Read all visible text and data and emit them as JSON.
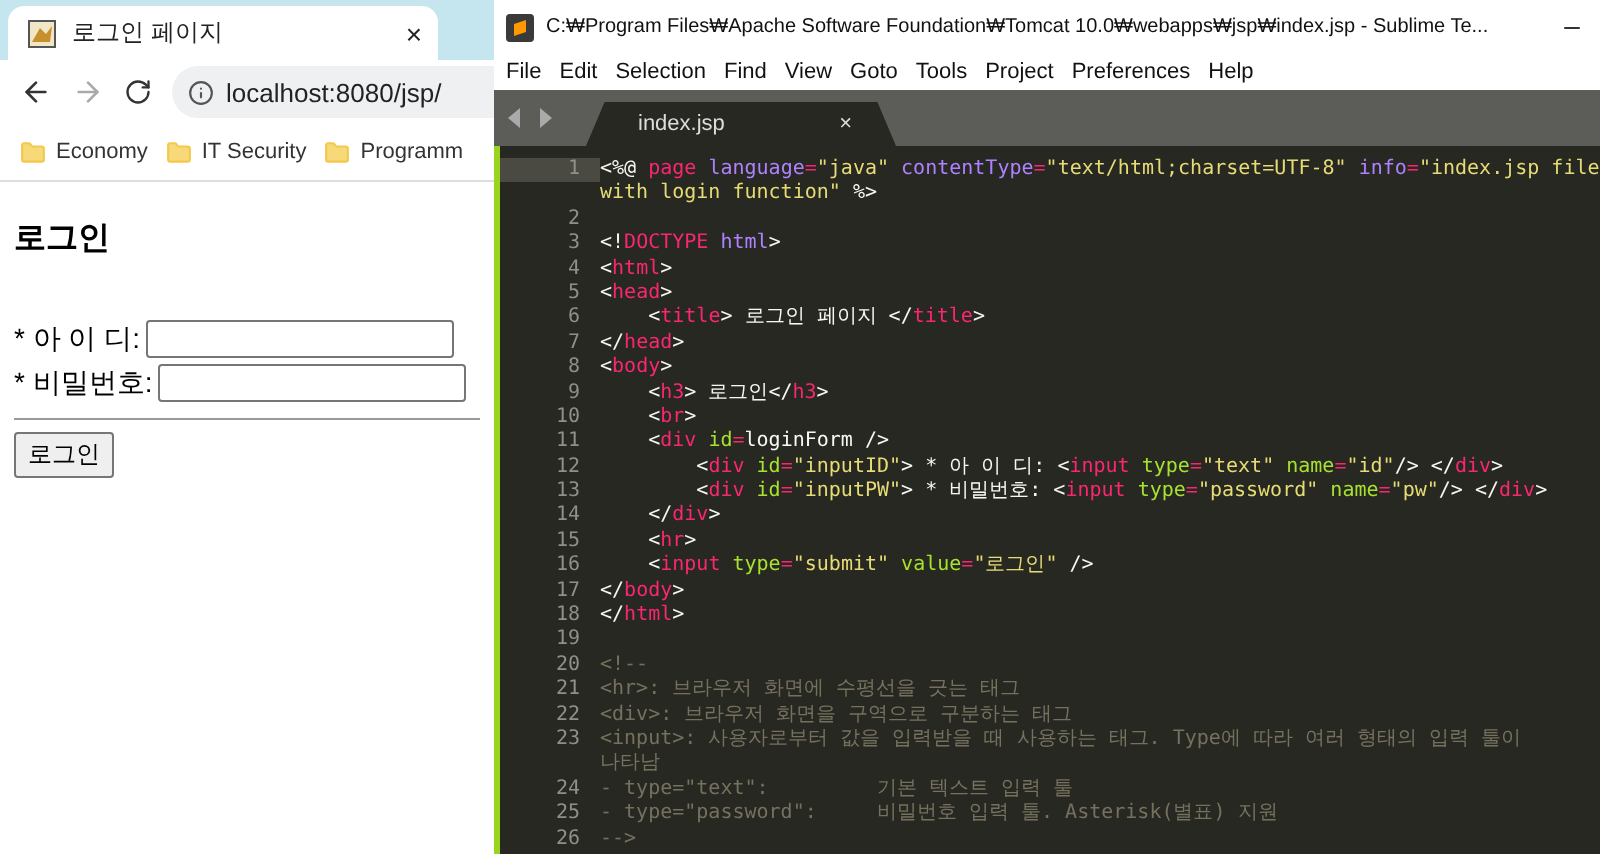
{
  "browser": {
    "tab": {
      "title": "로그인 페이지",
      "close": "×",
      "selected": true
    },
    "address": {
      "url": "localhost:8080/jsp/"
    },
    "bookmarks": [
      "Economy",
      "IT Security",
      "Programm"
    ],
    "page": {
      "heading": "로그인",
      "fields": [
        {
          "label": "* 아 이 디:"
        },
        {
          "label": "* 비밀번호:"
        }
      ],
      "button": "로그인"
    }
  },
  "editor": {
    "title": "C:₩Program Files₩Apache Software Foundation₩Tomcat 10.0₩webapps₩jsp₩index.jsp - Sublime Te...",
    "menu": [
      "File",
      "Edit",
      "Selection",
      "Find",
      "View",
      "Goto",
      "Tools",
      "Project",
      "Preferences",
      "Help"
    ],
    "tab": {
      "name": "index.jsp",
      "close": "×",
      "selected": true
    },
    "lines": [
      {
        "number": "1",
        "current": true,
        "tokens": [
          {
            "kind": "text",
            "text": "<%@"
          },
          {
            "kind": "tag",
            "text": " page"
          },
          {
            "kind": "directive",
            "text": " language"
          },
          {
            "kind": "op",
            "text": "="
          },
          {
            "kind": "string",
            "text": "\"java\""
          },
          {
            "kind": "directive",
            "text": " contentType"
          },
          {
            "kind": "op",
            "text": "="
          },
          {
            "kind": "string",
            "text": "\"text/html;charset=UTF-8\""
          },
          {
            "kind": "directive",
            "text": " info"
          },
          {
            "kind": "op",
            "text": "="
          },
          {
            "kind": "string",
            "text": "\"index.jsp file"
          }
        ],
        "wrap": [
          {
            "kind": "string",
            "text": "with login function\""
          },
          {
            "kind": "text",
            "text": " %>"
          }
        ]
      },
      {
        "number": "2",
        "current": false
      },
      {
        "number": "3",
        "current": false,
        "tokens": [
          {
            "kind": "text",
            "text": "<!"
          },
          {
            "kind": "tag",
            "text": "DOCTYPE"
          },
          {
            "kind": "directive",
            "text": " html"
          },
          {
            "kind": "text",
            "text": ">"
          }
        ]
      },
      {
        "number": "4",
        "current": false,
        "tokens": [
          {
            "kind": "text",
            "text": "<"
          },
          {
            "kind": "tag",
            "text": "html"
          },
          {
            "kind": "text",
            "text": ">"
          }
        ]
      },
      {
        "number": "5",
        "current": false,
        "tokens": [
          {
            "kind": "text",
            "text": "<"
          },
          {
            "kind": "tag",
            "text": "head"
          },
          {
            "kind": "text",
            "text": ">"
          }
        ]
      },
      {
        "number": "6",
        "current": false,
        "tokens": [
          {
            "kind": "text",
            "text": "    <"
          },
          {
            "kind": "tag",
            "text": "title"
          },
          {
            "kind": "text",
            "text": "> 로그인 페이지 </"
          },
          {
            "kind": "tag",
            "text": "title"
          },
          {
            "kind": "text",
            "text": ">"
          }
        ]
      },
      {
        "number": "7",
        "current": false,
        "tokens": [
          {
            "kind": "text",
            "text": "</"
          },
          {
            "kind": "tag",
            "text": "head"
          },
          {
            "kind": "text",
            "text": ">"
          }
        ]
      },
      {
        "number": "8",
        "current": false,
        "tokens": [
          {
            "kind": "text",
            "text": "<"
          },
          {
            "kind": "tag",
            "text": "body"
          },
          {
            "kind": "text",
            "text": ">"
          }
        ]
      },
      {
        "number": "9",
        "current": false,
        "tokens": [
          {
            "kind": "text",
            "text": "    <"
          },
          {
            "kind": "tag",
            "text": "h3"
          },
          {
            "kind": "text",
            "text": "> 로그인</"
          },
          {
            "kind": "tag",
            "text": "h3"
          },
          {
            "kind": "text",
            "text": ">"
          }
        ]
      },
      {
        "number": "10",
        "current": false,
        "tokens": [
          {
            "kind": "text",
            "text": "    <"
          },
          {
            "kind": "tag",
            "text": "br"
          },
          {
            "kind": "text",
            "text": ">"
          }
        ]
      },
      {
        "number": "11",
        "current": false,
        "tokens": [
          {
            "kind": "text",
            "text": "    <"
          },
          {
            "kind": "tag",
            "text": "div"
          },
          {
            "kind": "attr",
            "text": " id"
          },
          {
            "kind": "op",
            "text": "="
          },
          {
            "kind": "text",
            "text": "loginForm />"
          }
        ]
      },
      {
        "number": "12",
        "current": false,
        "tokens": [
          {
            "kind": "text",
            "text": "        <"
          },
          {
            "kind": "tag",
            "text": "div"
          },
          {
            "kind": "attr",
            "text": " id"
          },
          {
            "kind": "op",
            "text": "="
          },
          {
            "kind": "string",
            "text": "\"inputID\""
          },
          {
            "kind": "text",
            "text": "> * 아 이 디: <"
          },
          {
            "kind": "tag",
            "text": "input"
          },
          {
            "kind": "attr",
            "text": " type"
          },
          {
            "kind": "op",
            "text": "="
          },
          {
            "kind": "string",
            "text": "\"text\""
          },
          {
            "kind": "attr",
            "text": " name"
          },
          {
            "kind": "op",
            "text": "="
          },
          {
            "kind": "string",
            "text": "\"id\""
          },
          {
            "kind": "text",
            "text": "/> </"
          },
          {
            "kind": "tag",
            "text": "div"
          },
          {
            "kind": "text",
            "text": ">"
          }
        ]
      },
      {
        "number": "13",
        "current": false,
        "tokens": [
          {
            "kind": "text",
            "text": "        <"
          },
          {
            "kind": "tag",
            "text": "div"
          },
          {
            "kind": "attr",
            "text": " id"
          },
          {
            "kind": "op",
            "text": "="
          },
          {
            "kind": "string",
            "text": "\"inputPW\""
          },
          {
            "kind": "text",
            "text": "> * 비밀번호: <"
          },
          {
            "kind": "tag",
            "text": "input"
          },
          {
            "kind": "attr",
            "text": " type"
          },
          {
            "kind": "op",
            "text": "="
          },
          {
            "kind": "string",
            "text": "\"password\""
          },
          {
            "kind": "attr",
            "text": " name"
          },
          {
            "kind": "op",
            "text": "="
          },
          {
            "kind": "string",
            "text": "\"pw\""
          },
          {
            "kind": "text",
            "text": "/> </"
          },
          {
            "kind": "tag",
            "text": "div"
          },
          {
            "kind": "text",
            "text": ">"
          }
        ]
      },
      {
        "number": "14",
        "current": false,
        "tokens": [
          {
            "kind": "text",
            "text": "    </"
          },
          {
            "kind": "tag",
            "text": "div"
          },
          {
            "kind": "text",
            "text": ">"
          }
        ]
      },
      {
        "number": "15",
        "current": false,
        "tokens": [
          {
            "kind": "text",
            "text": "    <"
          },
          {
            "kind": "tag",
            "text": "hr"
          },
          {
            "kind": "text",
            "text": ">"
          }
        ]
      },
      {
        "number": "16",
        "current": false,
        "tokens": [
          {
            "kind": "text",
            "text": "    <"
          },
          {
            "kind": "tag",
            "text": "input"
          },
          {
            "kind": "attr",
            "text": " type"
          },
          {
            "kind": "op",
            "text": "="
          },
          {
            "kind": "string",
            "text": "\"submit\""
          },
          {
            "kind": "attr",
            "text": " value"
          },
          {
            "kind": "op",
            "text": "="
          },
          {
            "kind": "string",
            "text": "\"로그인\""
          },
          {
            "kind": "text",
            "text": " />"
          }
        ]
      },
      {
        "number": "17",
        "current": false,
        "tokens": [
          {
            "kind": "text",
            "text": "</"
          },
          {
            "kind": "tag",
            "text": "body"
          },
          {
            "kind": "text",
            "text": ">"
          }
        ]
      },
      {
        "number": "18",
        "current": false,
        "tokens": [
          {
            "kind": "text",
            "text": "</"
          },
          {
            "kind": "tag",
            "text": "html"
          },
          {
            "kind": "text",
            "text": ">"
          }
        ]
      },
      {
        "number": "19",
        "current": false
      },
      {
        "number": "20",
        "current": false,
        "tokens": [
          {
            "kind": "comment",
            "text": "<!--"
          }
        ]
      },
      {
        "number": "21",
        "current": false,
        "tokens": [
          {
            "kind": "comment",
            "text": "<hr>: 브라우저 화면에 수평선을 긋는 태그"
          }
        ]
      },
      {
        "number": "22",
        "current": false,
        "tokens": [
          {
            "kind": "comment",
            "text": "<div>: 브라우저 화면을 구역으로 구분하는 태그"
          }
        ]
      },
      {
        "number": "23",
        "current": false,
        "tokens": [
          {
            "kind": "comment",
            "text": "<input>: 사용자로부터 값을 입력받을 때 사용하는 태그. Type에 따라 여러 형태의 입력 툴이"
          }
        ],
        "wrap": [
          {
            "kind": "comment",
            "text": "나타남"
          }
        ]
      },
      {
        "number": "24",
        "current": false,
        "tokens": [
          {
            "kind": "comment",
            "text": "- type=\"text\":         기본 텍스트 입력 툴"
          }
        ]
      },
      {
        "number": "25",
        "current": false,
        "tokens": [
          {
            "kind": "comment",
            "text": "- type=\"password\":     비밀번호 입력 툴. Asterisk(별표) 지원"
          }
        ]
      },
      {
        "number": "26",
        "current": false,
        "tokens": [
          {
            "kind": "comment",
            "text": "-->"
          }
        ]
      }
    ]
  }
}
